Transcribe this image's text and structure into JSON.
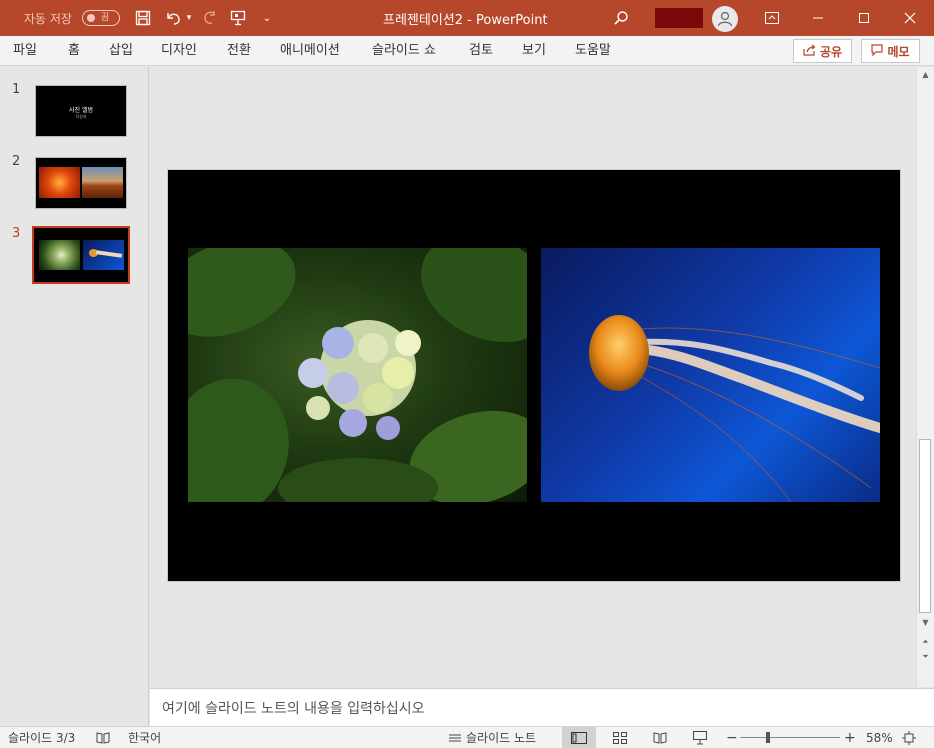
{
  "titlebar": {
    "autosave_label": "자동 저장",
    "autosave_state": "끔",
    "doc_title": "프레젠테이션2  -  PowerPoint"
  },
  "ribbon": {
    "tabs": [
      "파일",
      "홈",
      "삽입",
      "디자인",
      "전환",
      "애니메이션",
      "슬라이드 쇼",
      "검토",
      "보기",
      "도움말"
    ],
    "share_label": "공유",
    "memo_label": "메모"
  },
  "thumbnails": {
    "numbers": [
      "1",
      "2",
      "3"
    ],
    "slide1_title": "사진 앨범",
    "slide1_sub": "작성자"
  },
  "notes": {
    "placeholder": "여기에 슬라이드 노트의 내용을 입력하십시오"
  },
  "status": {
    "slide_counter": "슬라이드 3/3",
    "language": "한국어",
    "notes_button": "슬라이드 노트",
    "zoom_level": "58%"
  },
  "colors": {
    "accent": "#b7472a",
    "active_slide": "#c43e1c"
  }
}
